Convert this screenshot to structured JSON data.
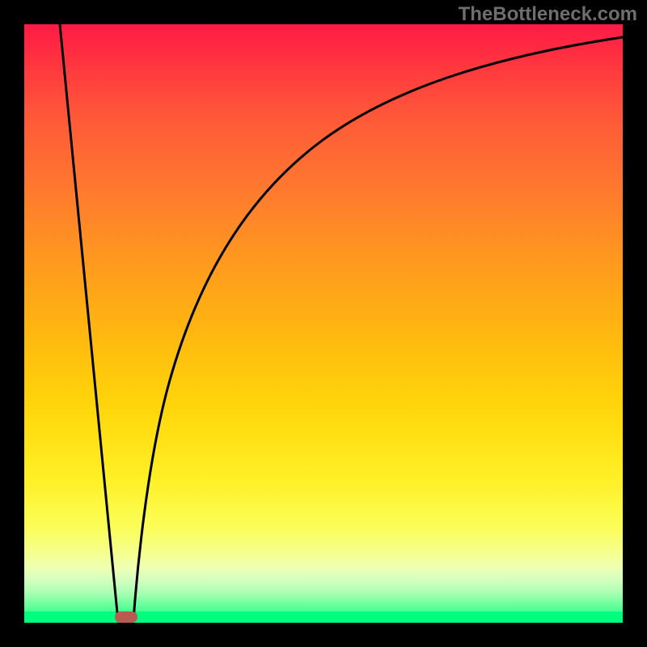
{
  "watermark": "TheBottleneck.com",
  "colors": {
    "gradient_top": "#ff1a45",
    "gradient_mid": "#ffd60a",
    "gradient_bottom": "#00ff7f",
    "curve": "#000000",
    "marker": "#b85c52",
    "frame": "#000000",
    "watermark_text": "#6e6e6e"
  },
  "chart_data": {
    "type": "line",
    "title": "",
    "xlabel": "",
    "ylabel": "",
    "xlim": [
      0,
      100
    ],
    "ylim": [
      0,
      100
    ],
    "series": [
      {
        "name": "bottleneck-curve",
        "x": [
          6,
          10,
          17,
          20,
          25,
          30,
          35,
          40,
          50,
          60,
          70,
          80,
          90,
          100
        ],
        "values": [
          100,
          50,
          0,
          20,
          40,
          55,
          65,
          72,
          82,
          88,
          92,
          95,
          97,
          98
        ]
      }
    ],
    "annotations": [
      {
        "name": "optimal-point",
        "x": 17,
        "y": 0
      }
    ],
    "background": "vertical-gradient red→yellow→green (green at y=0)"
  }
}
